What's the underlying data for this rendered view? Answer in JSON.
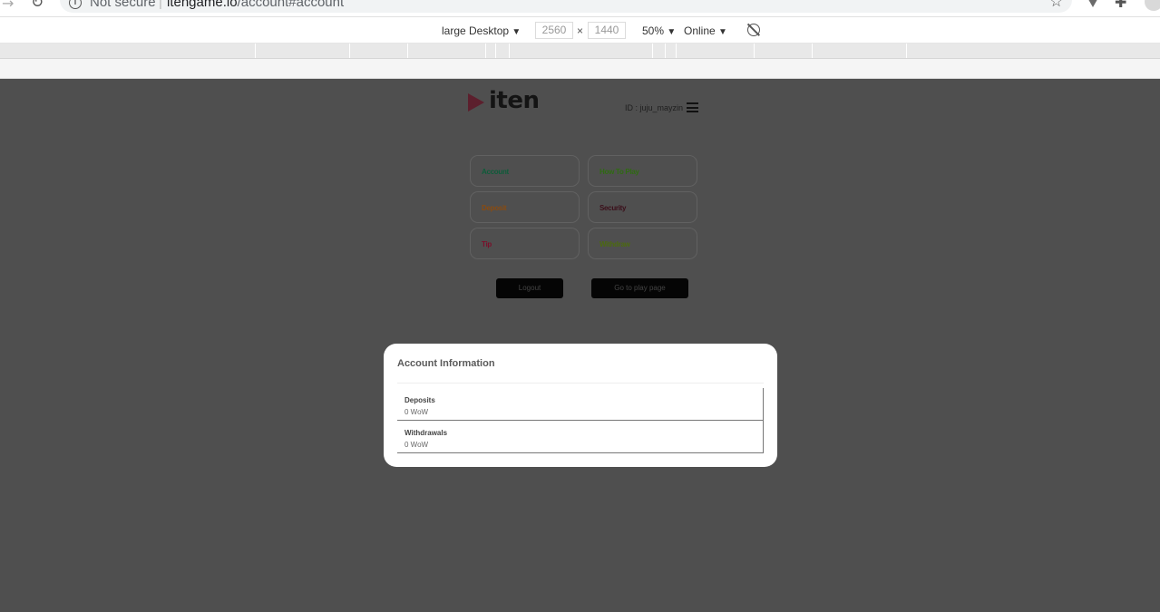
{
  "browser": {
    "security_label": "Not secure",
    "separator": "|",
    "url_host": "itengame.io",
    "url_path": "/account#account"
  },
  "device_toolbar": {
    "device": "large Desktop",
    "width": "2560",
    "height": "1440",
    "times": "×",
    "zoom": "50%",
    "network": "Online",
    "caret": "▼"
  },
  "page": {
    "logo_text": "iten",
    "user_id": "ID : juju_mayzin",
    "menu": [
      {
        "label": "Account",
        "color": "#0e5c3a"
      },
      {
        "label": "How To Play",
        "color": "#2f6b12"
      },
      {
        "label": "Deposit",
        "color": "#8a4b10"
      },
      {
        "label": "Security",
        "color": "#3b0f1a"
      },
      {
        "label": "Tip",
        "color": "#7a0f2a"
      },
      {
        "label": "Withdraw",
        "color": "#4c6a10"
      }
    ],
    "logout_label": "Logout",
    "play_label": "Go to play page"
  },
  "modal": {
    "title": "Account Information",
    "rows": [
      {
        "label": "Deposits",
        "value": "0 WoW"
      },
      {
        "label": "Withdrawals",
        "value": "0 WoW"
      }
    ]
  }
}
